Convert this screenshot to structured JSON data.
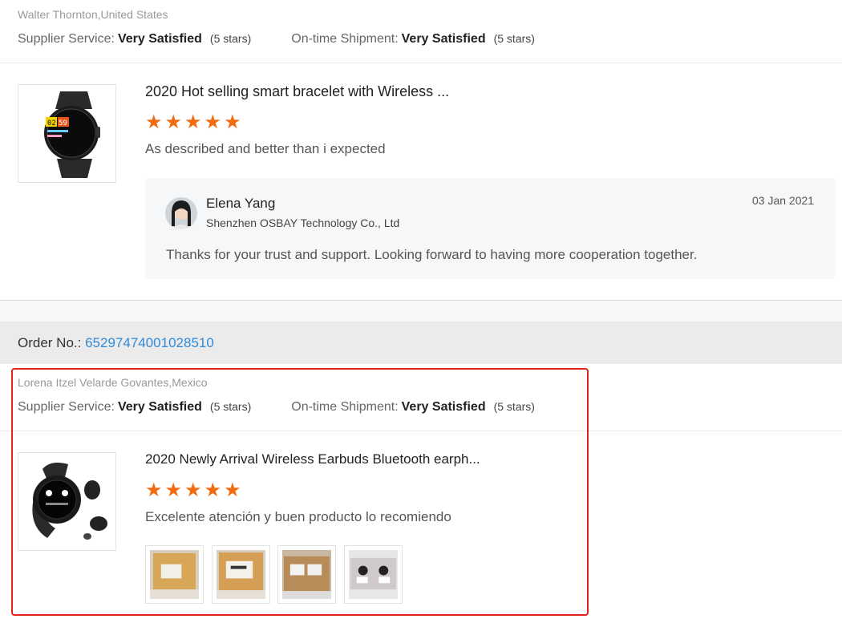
{
  "review1": {
    "reviewer": "Walter Thornton,United States",
    "supplier_service_label": "Supplier Service:",
    "supplier_service_value": "Very Satisfied",
    "supplier_service_stars": "(5 stars)",
    "shipment_label": "On-time Shipment:",
    "shipment_value": "Very Satisfied",
    "shipment_stars": "(5 stars)",
    "product_title": "2020 Hot selling smart bracelet with Wireless ...",
    "rating": 5,
    "comment": "As described and better than i expected",
    "watch_display": [
      "02",
      "59"
    ],
    "reply": {
      "name": "Elena Yang",
      "company": "Shenzhen OSBAY Technology Co., Ltd",
      "date": "03 Jan 2021",
      "text": "Thanks for your trust and support. Looking forward to having more cooperation together."
    }
  },
  "order": {
    "label": "Order No.:",
    "number": "65297474001028510"
  },
  "review2": {
    "reviewer": "Lorena Itzel Velarde Govantes,Mexico",
    "supplier_service_label": "Supplier Service:",
    "supplier_service_value": "Very Satisfied",
    "supplier_service_stars": "(5 stars)",
    "shipment_label": "On-time Shipment:",
    "shipment_value": "Very Satisfied",
    "shipment_stars": "(5 stars)",
    "product_title": "2020 Newly Arrival Wireless Earbuds Bluetooth earph...",
    "rating": 5,
    "comment": "Excelente atención y buen producto lo recomiendo",
    "photo_count": 4
  },
  "colors": {
    "star": "#f26b0f",
    "order_link": "#2f8ad8",
    "highlight": "#e2231a"
  }
}
